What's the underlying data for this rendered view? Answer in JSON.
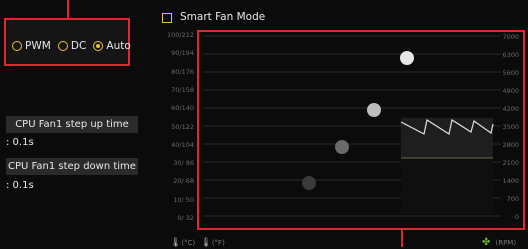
{
  "header": {
    "title": "Smart Fan Mode",
    "smart_fan_checked": false
  },
  "mode": {
    "options": [
      {
        "label": "PWM",
        "selected": false
      },
      {
        "label": "DC",
        "selected": false
      },
      {
        "label": "Auto",
        "selected": true
      }
    ]
  },
  "step_up": {
    "label": "CPU Fan1 step up time",
    "value": ": 0.1s"
  },
  "step_down": {
    "label": "CPU Fan1 step down time",
    "value": ": 0.1s"
  },
  "chart": {
    "left_ticks": [
      "100/212",
      "90/194",
      "80/176",
      "70/158",
      "60/140",
      "50/122",
      "40/104",
      "30/ 86",
      "20/ 68",
      "10/ 50",
      "0/ 32"
    ],
    "right_ticks": [
      "7000",
      "6300",
      "5600",
      "4900",
      "4200",
      "3500",
      "2800",
      "2100",
      "1400",
      "700",
      "0"
    ],
    "footer_left": "(°C)",
    "footer_left2": "(°F)",
    "footer_right": "(RPM)"
  },
  "colors": {
    "accent_yellow": "#e8c437",
    "highlight_red": "#e0262f"
  }
}
